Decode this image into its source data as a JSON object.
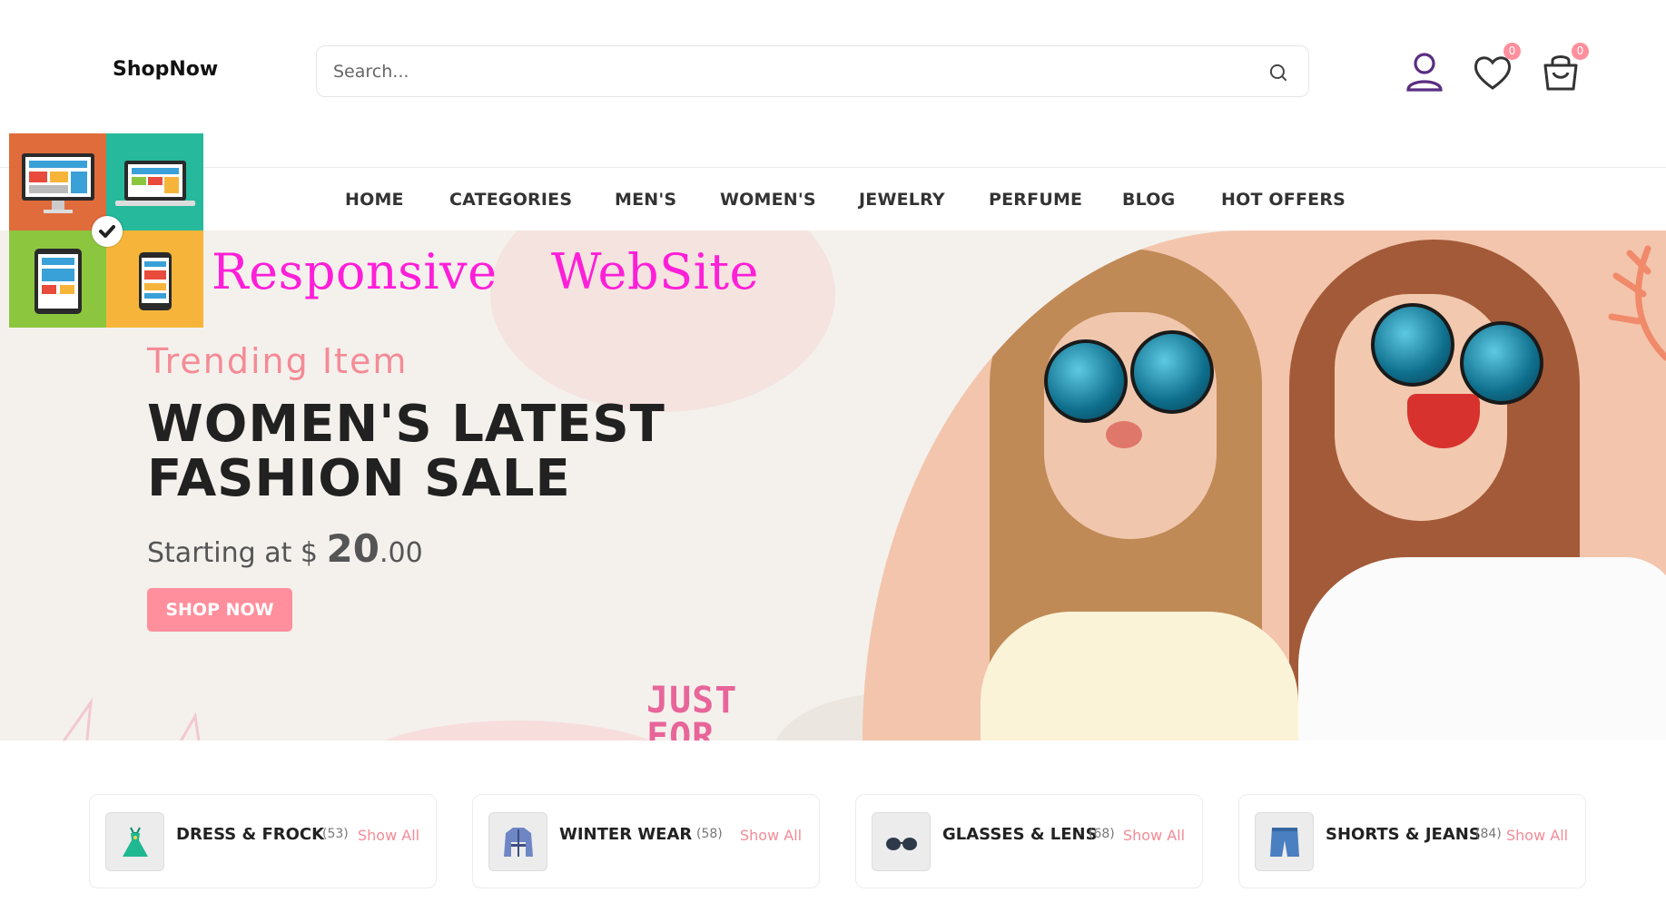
{
  "header": {
    "logo": "ShopNow",
    "search_placeholder": "Search...",
    "wishlist_count": "0",
    "cart_count": "0"
  },
  "nav": {
    "items": [
      "HOME",
      "CATEGORIES",
      "MEN'S",
      "WOMEN'S",
      "JEWELRY",
      "PERFUME",
      "BLOG",
      "HOT OFFERS"
    ]
  },
  "overlay": {
    "text": "Responsive  WebSite"
  },
  "hero": {
    "subtitle": "Trending Item",
    "title_line1": "WOMEN'S LATEST",
    "title_line2": "FASHION SALE",
    "price_prefix": "Starting at $ ",
    "price_whole": "20",
    "price_cents": ".00",
    "cta": "SHOP NOW",
    "decor_text_line1": "JUST",
    "decor_text_line2": "FOR"
  },
  "categories": [
    {
      "name": "DRESS & FROCK",
      "count": "(53)",
      "link": "Show All",
      "icon": "dress-icon"
    },
    {
      "name": "WINTER WEAR",
      "count": "(58)",
      "link": "Show All",
      "icon": "coat-icon"
    },
    {
      "name": "GLASSES & LENS",
      "count": "(68)",
      "link": "Show All",
      "icon": "glasses-icon"
    },
    {
      "name": "SHORTS & JEANS",
      "count": "(84)",
      "link": "Show All",
      "icon": "shorts-icon"
    }
  ],
  "colors": {
    "accent": "#ff8f9c",
    "overlay_text": "#ff1fd8",
    "heading": "#212121",
    "user_icon": "#5a2d82"
  }
}
